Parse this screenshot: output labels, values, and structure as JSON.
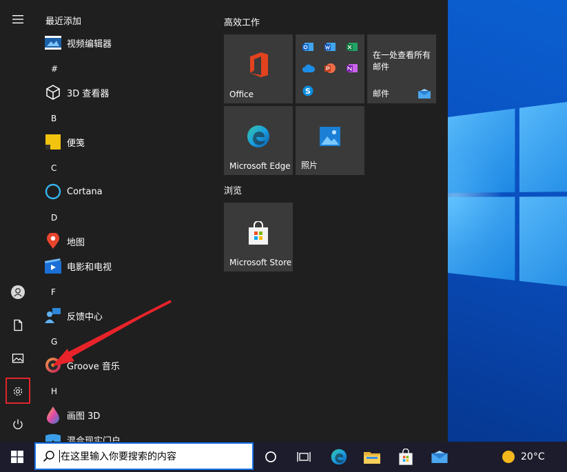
{
  "applist": {
    "recent_header": "最近添加",
    "letters": {
      "hash": "#",
      "b": "B",
      "c": "C",
      "d": "D",
      "f": "F",
      "g": "G",
      "h": "H"
    },
    "apps": {
      "video_editor": "视频编辑器",
      "viewer_3d": "3D 查看器",
      "sticky_notes": "便笺",
      "cortana": "Cortana",
      "maps": "地图",
      "movies_tv": "电影和电视",
      "feedback_hub": "反馈中心",
      "groove": "Groove 音乐",
      "paint_3d": "画图 3D",
      "mixed_reality": "混合现实门户"
    }
  },
  "tiles": {
    "group_productivity": "高效工作",
    "group_browse": "浏览",
    "office": "Office",
    "mail_text": "在一处查看所有邮件",
    "mail": "邮件",
    "edge": "Microsoft Edge",
    "photos": "照片",
    "store": "Microsoft Store"
  },
  "taskbar": {
    "search_placeholder": "在这里输入你要搜索的内容",
    "weather": "20°C"
  },
  "colors": {
    "start_bg": "#1f1f1f",
    "tile_bg": "#3a3a3a",
    "highlight": "#e0262b",
    "taskbar_bg": "#1c1c2c"
  }
}
